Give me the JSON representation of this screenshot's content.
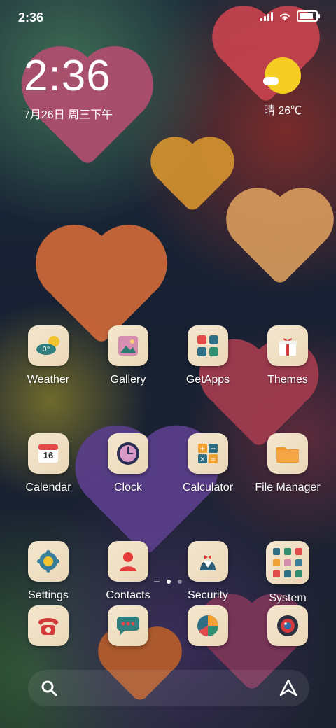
{
  "status_bar": {
    "time": "2:36"
  },
  "clock_widget": {
    "time": "2:36",
    "date": "7月26日 周三下午"
  },
  "weather_widget": {
    "condition": "晴",
    "temperature": "26℃"
  },
  "apps": [
    {
      "label": "Weather",
      "icon": "weather-icon"
    },
    {
      "label": "Gallery",
      "icon": "gallery-icon"
    },
    {
      "label": "GetApps",
      "icon": "getapps-icon"
    },
    {
      "label": "Themes",
      "icon": "gift-icon"
    },
    {
      "label": "Calendar",
      "icon": "calendar-icon",
      "date": "16"
    },
    {
      "label": "Clock",
      "icon": "clock-icon"
    },
    {
      "label": "Calculator",
      "icon": "calculator-icon"
    },
    {
      "label": "File Manager",
      "icon": "folder-icon"
    },
    {
      "label": "Settings",
      "icon": "gear-icon"
    },
    {
      "label": "Contacts",
      "icon": "person-icon"
    },
    {
      "label": "Security",
      "icon": "security-icon"
    },
    {
      "label": "System",
      "icon": "folder-grid-icon"
    }
  ],
  "page_indicator": {
    "pages": 2,
    "active": 1
  },
  "dock": [
    {
      "icon": "phone-icon"
    },
    {
      "icon": "messages-icon"
    },
    {
      "icon": "pie-chart-icon"
    },
    {
      "icon": "camera-icon"
    }
  ],
  "search_bar": {
    "left_icon": "search-icon",
    "right_icon": "assistant-icon"
  }
}
